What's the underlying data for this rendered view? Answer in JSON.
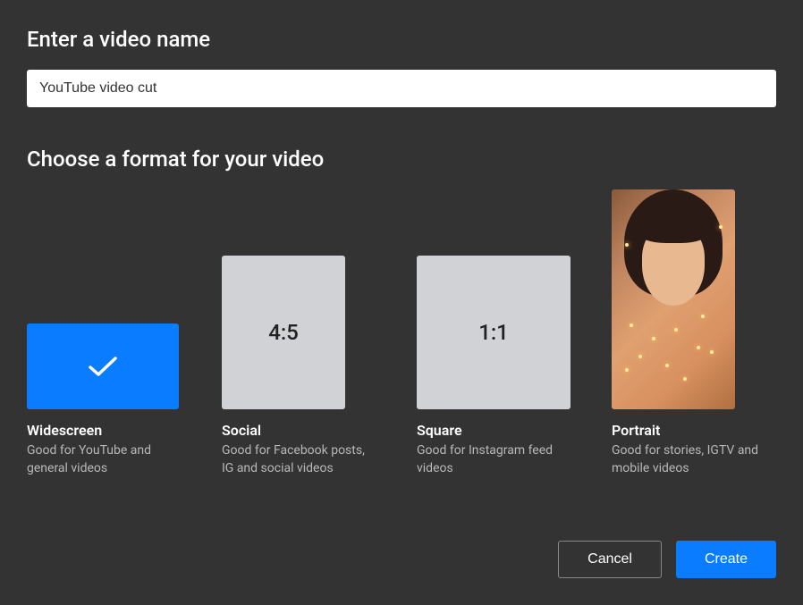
{
  "headings": {
    "name_label": "Enter a video name",
    "format_label": "Choose a format for your video"
  },
  "input": {
    "value": "YouTube video cut"
  },
  "formats": {
    "widescreen": {
      "title": "Widescreen",
      "desc": "Good for YouTube and general videos",
      "selected": true
    },
    "social": {
      "ratio": "4:5",
      "title": "Social",
      "desc": "Good for Facebook posts, IG and social videos"
    },
    "square": {
      "ratio": "1:1",
      "title": "Square",
      "desc": "Good for Instagram feed videos"
    },
    "portrait": {
      "title": "Portrait",
      "desc": "Good for stories, IGTV and mobile videos"
    }
  },
  "buttons": {
    "cancel": "Cancel",
    "create": "Create"
  }
}
